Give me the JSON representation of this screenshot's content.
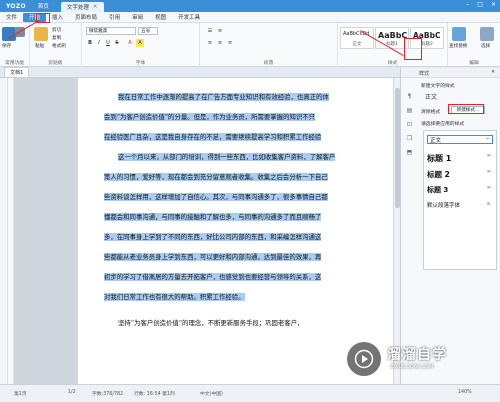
{
  "app": {
    "logo": "YOZO",
    "home_tab": "首页",
    "doc_tab": "文字处理"
  },
  "menu": [
    "文件",
    "开始",
    "插入",
    "页面布局",
    "引用",
    "审阅",
    "视图",
    "开发工具"
  ],
  "menu_active": "开始",
  "ribbon": {
    "save": "保存",
    "paste": "粘贴",
    "cut": "剪切",
    "copy": "复制",
    "format_painter": "格式刷",
    "groups": {
      "common": "常用功能",
      "clipboard": "剪贴板",
      "font": "字体",
      "paragraph": "段落",
      "style": "样式",
      "edit": "编辑"
    },
    "font_name": "微软雅黑",
    "font_size": "五号",
    "styles": [
      {
        "preview": "AaBbCcDd",
        "caption": "正文"
      },
      {
        "preview": "AaBbC",
        "caption": "标题1"
      },
      {
        "preview": "AaBbC",
        "caption": "标题2"
      }
    ],
    "find_replace": "查找替换",
    "select": "选择"
  },
  "doc_tab_label": "文档1",
  "paragraphs": [
    "我在日常工作中逐渐的提高了在广告方面专业知识和有效经验，也真正的体",
    "会到“为客户创造价值”的分量。但是，作为业务员，所需要掌握的知识不只",
    "在经验医广且杂，这是我自身存在的不足，需要继续提高学习和积累工作经验",
    "这一个月以来，从部门的培训，得到一些东西，比如收集客户资料，了解客户",
    "策人的习惯，爱好等，现在都会到充分留意观者收集。收集之后会分析一下自己",
    "些资料谈怎样用，这样增加了自信心。其次，与同事沟通多了，很多事情自己都",
    "懂都会和同事沟通，与同事的接触和了解也多，与同事的沟通多了而且顺畅了",
    "多，在同事身上学到了不同的东西，好比公司内部的东西，和采编怎样沟通这",
    "些都能从老业务员身上学到东西，可以更好和内部沟通，达到最佳的效果，再",
    "初步的学习了借离居的方量去开拓客户，也感觉到也要经营与领导的关系，这",
    "对我们日常工作也有很大的帮助。积累工作经验。"
  ],
  "last_paragraph": "坚持“为客户创造价值”的理念，不断更新服务手段；巩固老客户，",
  "pane": {
    "title": "样式",
    "new_style_section": "新建文字的样式",
    "current": "正文",
    "clear_format": "清除格式",
    "new_style_btn": "新建样式...",
    "apply_section": "请选择要应用的样式",
    "styles": [
      {
        "label": "正文",
        "marker": "↵"
      },
      {
        "label": "标题 1",
        "marker": "↵"
      },
      {
        "label": "标题 2",
        "marker": "↵"
      },
      {
        "label": "标题 3",
        "marker": "↵"
      },
      {
        "label": "默认段落字体",
        "marker": "a"
      }
    ]
  },
  "status": {
    "page": "第1页",
    "pages": "1/2",
    "chars": "字数:376/782",
    "row_col": "行数: 16:54 第1列",
    "lang": "中文(中国)",
    "zoom": "140%"
  },
  "watermark": {
    "brand": "溜溜自学",
    "url": "ZIXUE.3D66.COM"
  },
  "colors": {
    "accent": "#3a8fd6",
    "selection": "#a9cdf2",
    "annotation": "#e0232b"
  }
}
